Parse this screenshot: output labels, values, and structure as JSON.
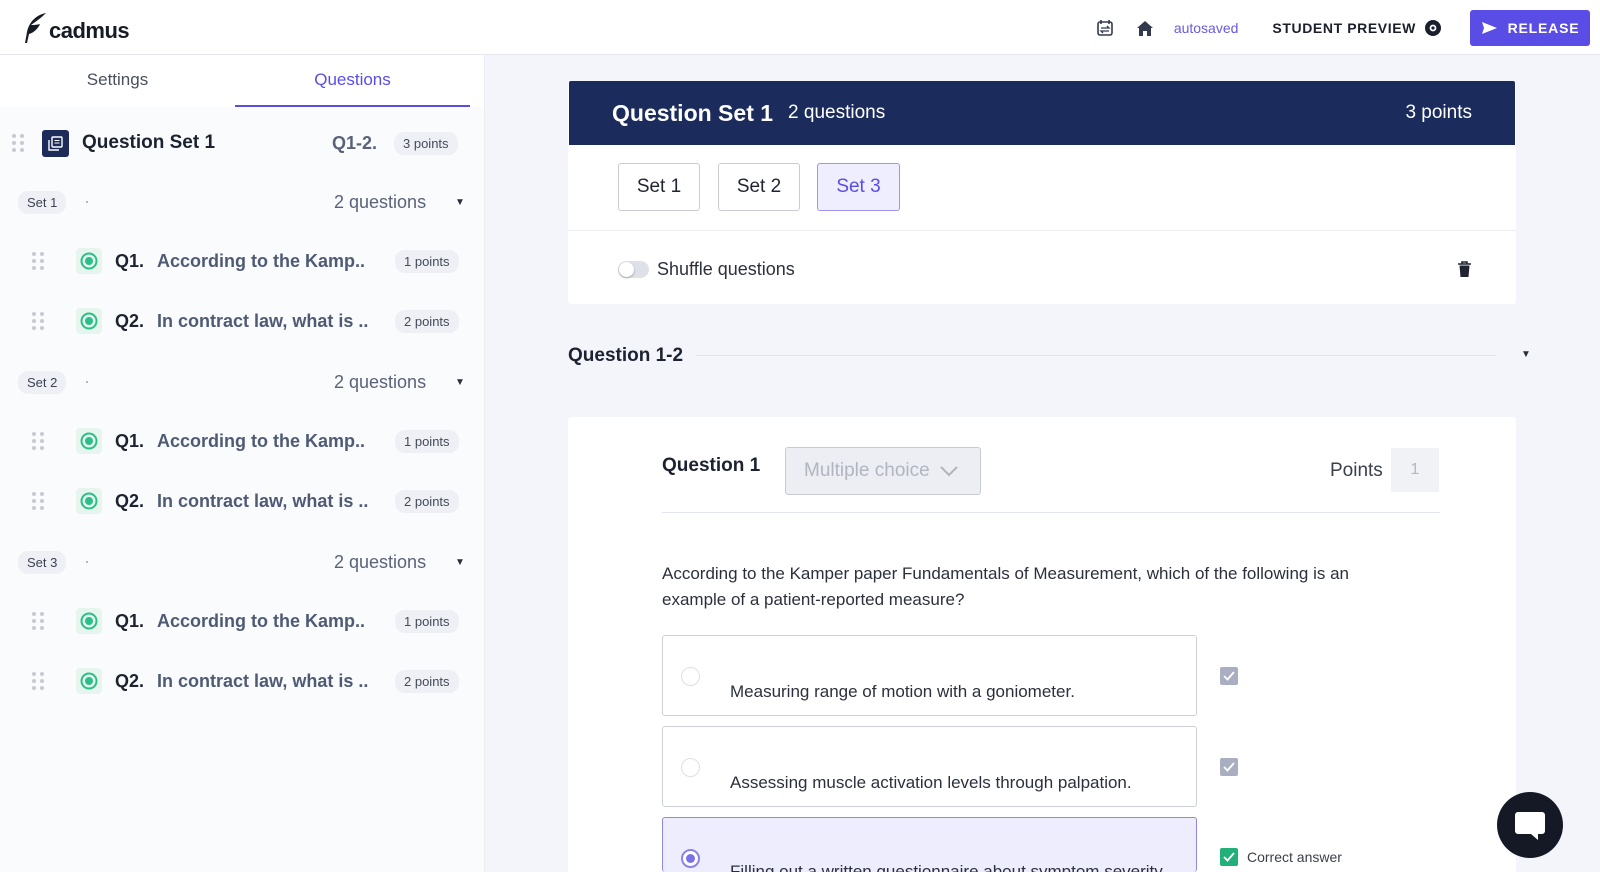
{
  "app": {
    "logo_text": "cadmus"
  },
  "topbar": {
    "autosaved": "autosaved",
    "student_preview": "STUDENT PREVIEW",
    "release": "RELEASE"
  },
  "sidebar": {
    "tabs": [
      {
        "label": "Settings",
        "active": false
      },
      {
        "label": "Questions",
        "active": true
      }
    ],
    "question_set": {
      "title": "Question Set 1",
      "range": "Q1-2.",
      "points": "3 points"
    },
    "sets": [
      {
        "label": "Set 1",
        "count": "2 questions",
        "questions": [
          {
            "num": "Q1.",
            "text": "According to the Kamp..",
            "points": "1 points"
          },
          {
            "num": "Q2.",
            "text": "In contract law, what is ..",
            "points": "2 points"
          }
        ]
      },
      {
        "label": "Set 2",
        "count": "2 questions",
        "questions": [
          {
            "num": "Q1.",
            "text": "According to the Kamp..",
            "points": "1 points"
          },
          {
            "num": "Q2.",
            "text": "In contract law, what is ..",
            "points": "2 points"
          }
        ]
      },
      {
        "label": "Set 3",
        "count": "2 questions",
        "questions": [
          {
            "num": "Q1.",
            "text": "According to the Kamp..",
            "points": "1 points"
          },
          {
            "num": "Q2.",
            "text": "In contract law, what is ..",
            "points": "2 points"
          }
        ]
      }
    ]
  },
  "main": {
    "header": {
      "title": "Question Set 1",
      "count": "2 questions",
      "points": "3 points"
    },
    "set_buttons": [
      {
        "label": "Set 1",
        "active": false
      },
      {
        "label": "Set 2",
        "active": false
      },
      {
        "label": "Set 3",
        "active": true
      }
    ],
    "shuffle": {
      "label": "Shuffle questions",
      "on": false
    },
    "question_range": "Question 1-2",
    "question": {
      "label": "Question 1",
      "type": "Multiple choice",
      "points_label": "Points",
      "points_value": "1",
      "prompt": "According to the Kamper paper Fundamentals of Measurement, which of the following is an example of a patient-reported measure?",
      "options": [
        {
          "text": "Measuring range of motion with a goniometer.",
          "selected": false,
          "correct": false
        },
        {
          "text": "Assessing muscle activation levels through palpation.",
          "selected": false,
          "correct": false
        },
        {
          "text": "Filling out a written questionnaire about symptom severity.",
          "selected": true,
          "correct": true
        }
      ],
      "correct_label": "Correct answer"
    }
  },
  "colors": {
    "accent": "#5a4de6",
    "header_navy": "#1a2b5c",
    "success": "#22b07a"
  }
}
